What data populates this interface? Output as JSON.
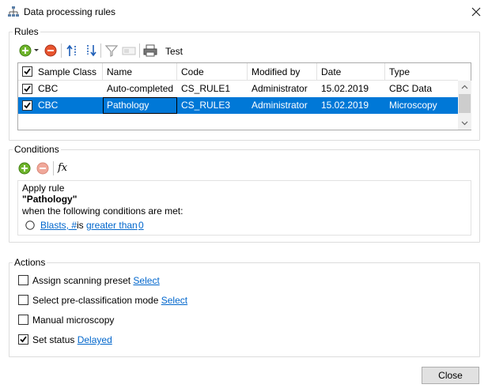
{
  "window": {
    "title": "Data processing rules",
    "title_icon": "hierarchy-icon",
    "close_icon": "close-icon"
  },
  "rules": {
    "label": "Rules",
    "toolbar": {
      "add_icon": "add-icon",
      "remove_icon": "remove-icon",
      "move_up_icon": "move-up-icon",
      "move_down_icon": "move-down-icon",
      "filter_icon": "filter-icon",
      "edit_icon": "edit-icon",
      "print_icon": "print-icon",
      "test_label": "Test"
    },
    "columns": [
      "Sample Class",
      "Name",
      "Code",
      "Modified by",
      "Date",
      "Type"
    ],
    "rows": [
      {
        "checked": true,
        "sample_class": "CBC",
        "name": "Auto-completed",
        "code": "CS_RULE1",
        "modified_by": "Administrator",
        "date": "15.02.2019",
        "type": "CBC Data",
        "selected": false
      },
      {
        "checked": true,
        "sample_class": "CBC",
        "name": "Pathology",
        "code": "CS_RULE3",
        "modified_by": "Administrator",
        "date": "15.02.2019",
        "type": "Microscopy",
        "selected": true
      }
    ]
  },
  "conditions": {
    "label": "Conditions",
    "toolbar": {
      "add_icon": "add-icon",
      "remove_icon": "remove-icon",
      "fx_label": "fx"
    },
    "apply_rule": "Apply rule",
    "rule_name": "\"Pathology\"",
    "when_text": "when the following conditions are met:",
    "condition": {
      "field": "Blasts, #",
      "is": "is",
      "operator": "greater than",
      "value": "0"
    }
  },
  "actions": {
    "label": "Actions",
    "items": [
      {
        "checked": false,
        "text": "Assign scanning preset",
        "link": "Select"
      },
      {
        "checked": false,
        "text": "Select pre-classification mode",
        "link": "Select"
      },
      {
        "checked": false,
        "text": "Manual microscopy",
        "link": ""
      },
      {
        "checked": true,
        "text": "Set status",
        "link": "Delayed"
      }
    ]
  },
  "footer": {
    "close_label": "Close"
  },
  "colors": {
    "selection": "#0078d7",
    "link": "#0066cc",
    "add_green": "#5aa016",
    "remove_red": "#e0442c"
  }
}
